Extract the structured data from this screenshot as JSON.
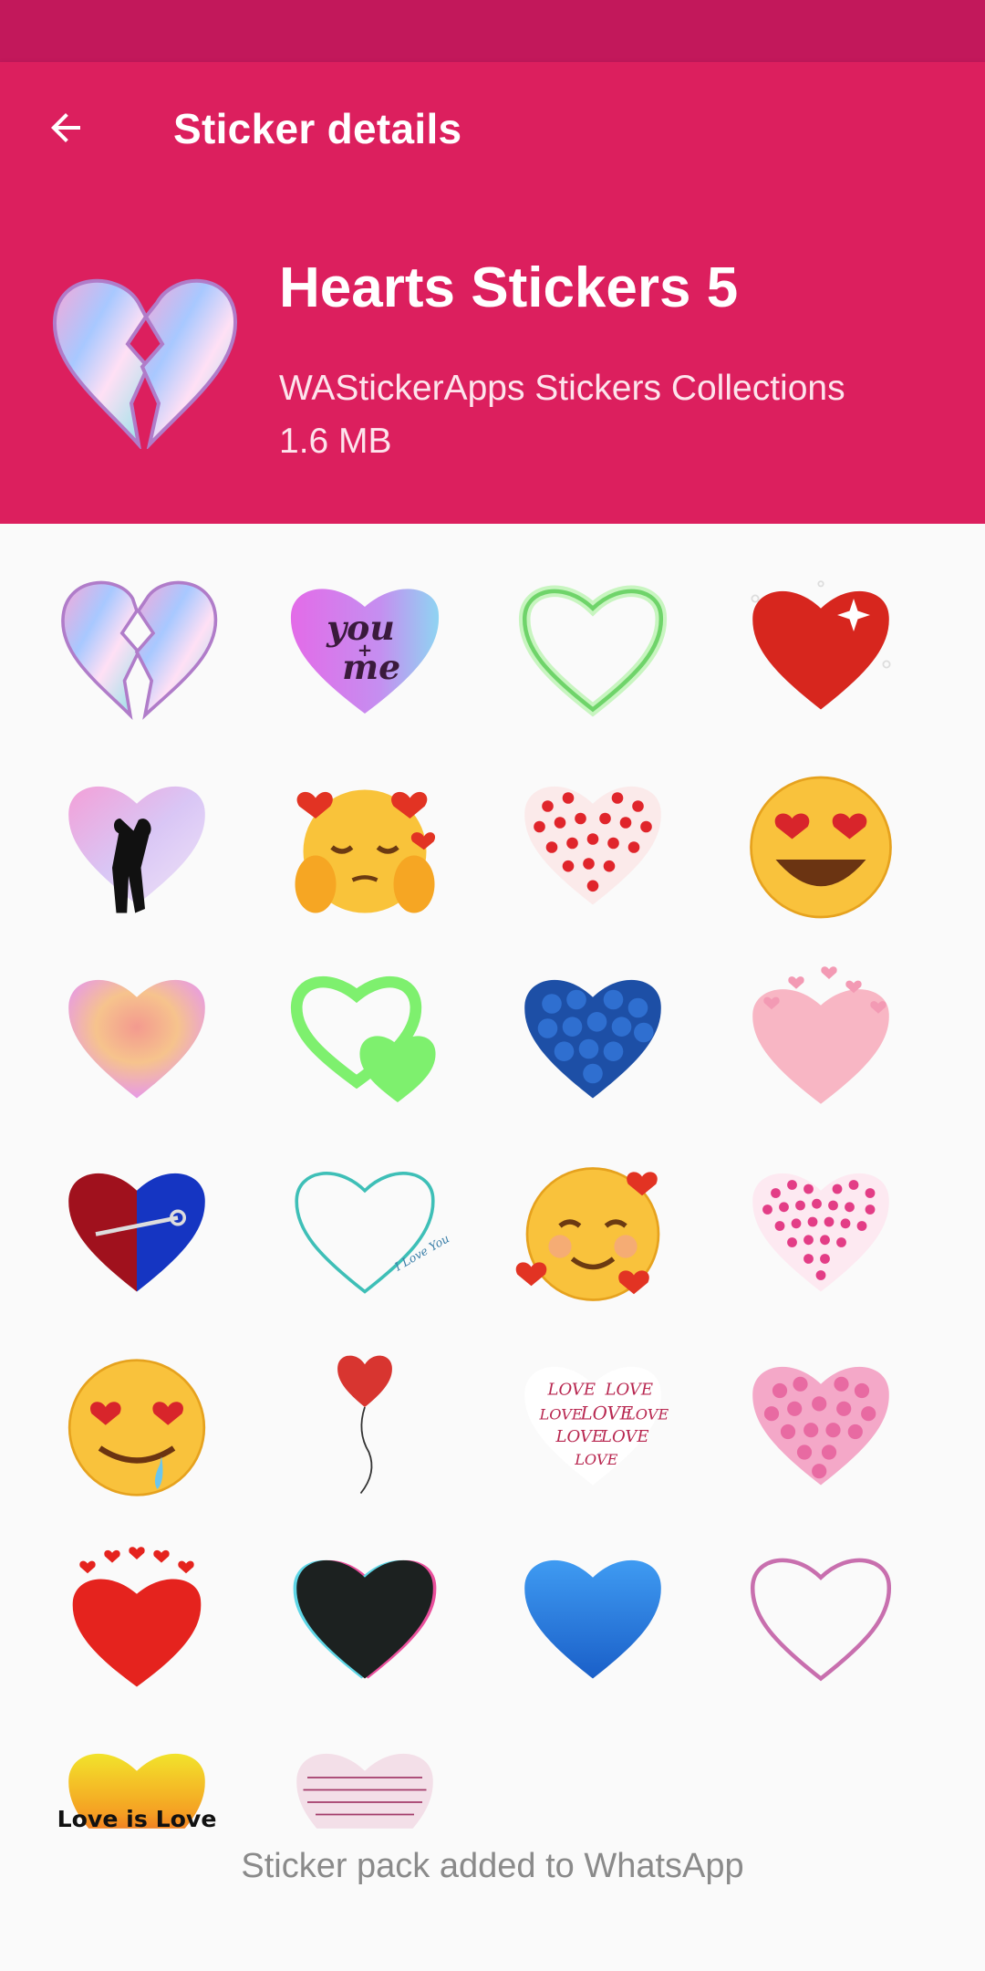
{
  "appbar": {
    "title": "Sticker details",
    "back_icon": "arrow-left-icon"
  },
  "pack": {
    "name": "Hearts Stickers 5",
    "publisher": "WAStickerApps Stickers Collections",
    "size": "1.6 MB"
  },
  "sticker_tray": {
    "caption_you": "you",
    "caption_plus": "+",
    "caption_me": "me",
    "caption_love": "LOVE",
    "caption_love_is_love": "Love is Love",
    "caption_i_love_you": "I Love You"
  },
  "footer": {
    "status": "Sticker pack added to WhatsApp"
  },
  "colors": {
    "statusbar": "#c2185b",
    "primary": "#dc1f5e",
    "background": "#fafafa"
  }
}
